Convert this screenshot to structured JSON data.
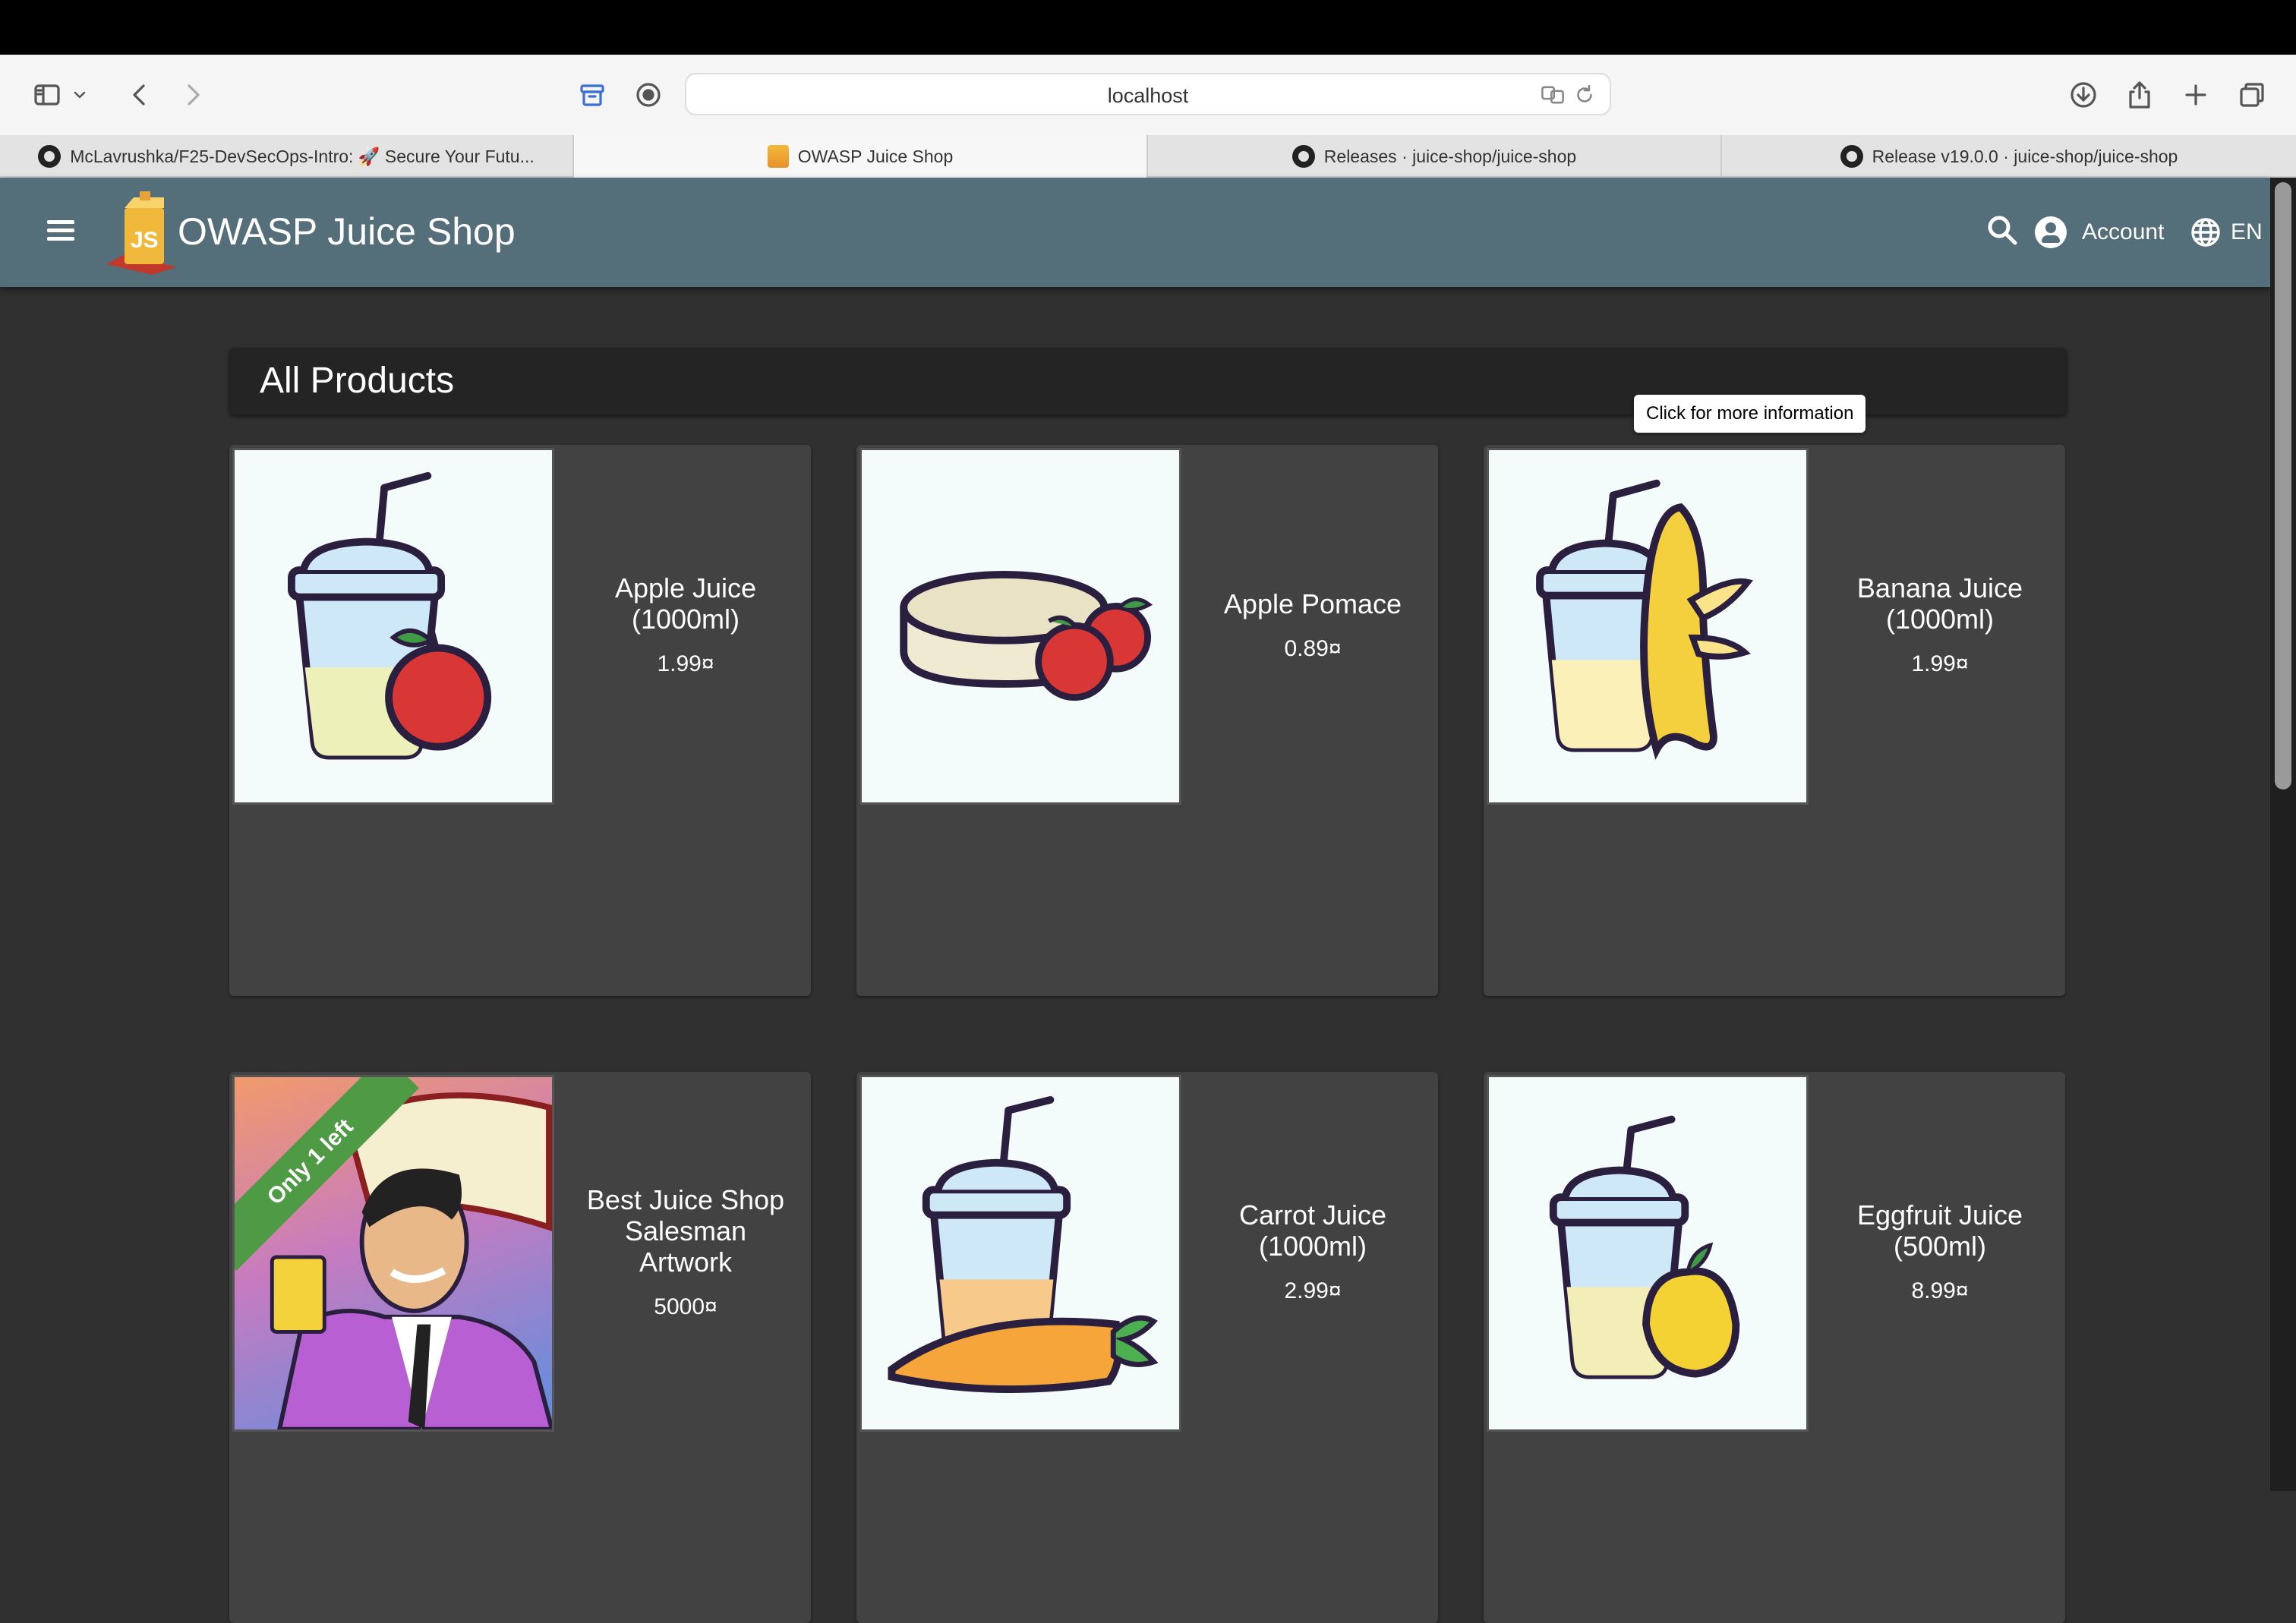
{
  "browser": {
    "url": "localhost",
    "tabs": [
      {
        "label": "McLavrushka/F25-DevSecOps-Intro: 🚀 Secure Your Futu...",
        "icon": "github-icon"
      },
      {
        "label": "OWASP Juice Shop",
        "icon": "juice-shop-favicon"
      },
      {
        "label": "Releases · juice-shop/juice-shop",
        "icon": "github-icon"
      },
      {
        "label": "Release v19.0.0 · juice-shop/juice-shop",
        "icon": "github-icon"
      }
    ]
  },
  "header": {
    "title": "OWASP Juice Shop",
    "account_label": "Account",
    "language": "EN"
  },
  "main": {
    "section_title": "All Products",
    "tooltip": "Click for more information",
    "products": [
      {
        "name": "Apple Juice (1000ml)",
        "price": "1.99¤"
      },
      {
        "name": "Apple Pomace",
        "price": "0.89¤"
      },
      {
        "name": "Banana Juice (1000ml)",
        "price": "1.99¤"
      },
      {
        "name": "Best Juice Shop Salesman Artwork",
        "price": "5000¤",
        "badge": "Only 1 left"
      },
      {
        "name": "Carrot Juice (1000ml)",
        "price": "2.99¤"
      },
      {
        "name": "Eggfruit Juice (500ml)",
        "price": "8.99¤"
      }
    ]
  },
  "colors": {
    "header": "#546e7a",
    "background": "#303030",
    "card": "#424242",
    "badge": "#4f9a45"
  }
}
